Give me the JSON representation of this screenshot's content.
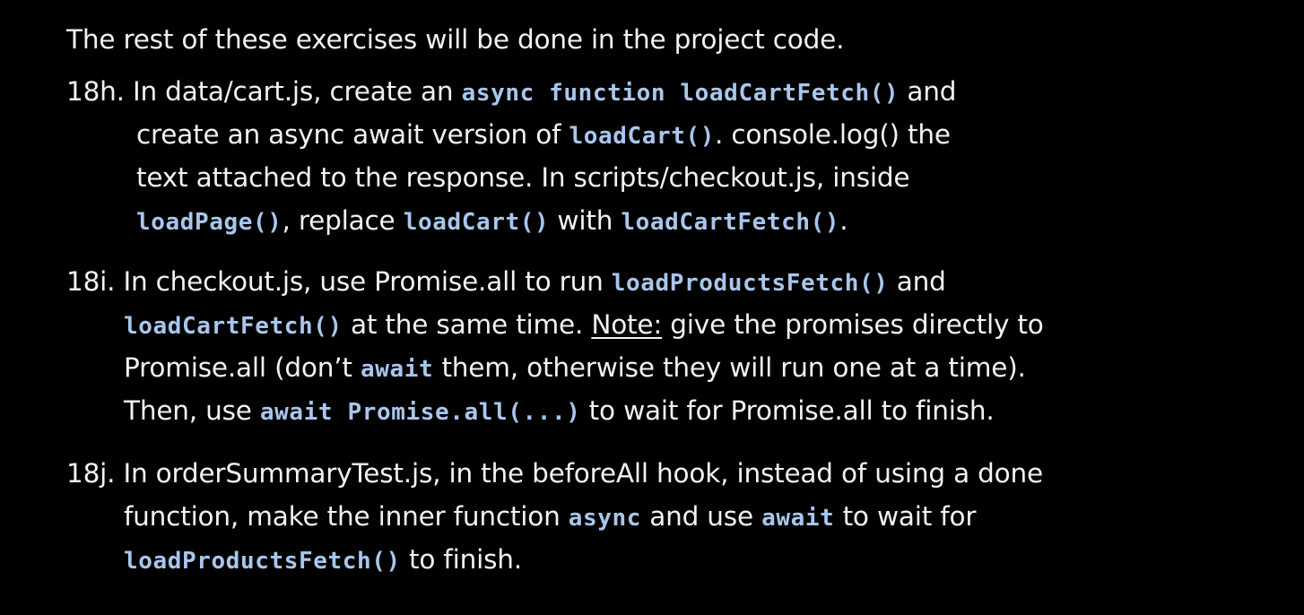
{
  "intro": "The rest of these exercises will be done in the project code.",
  "ex18h": {
    "label": "18h.",
    "l1_a": " In data/cart.js, create an ",
    "l1_code": "async function loadCartFetch()",
    "l1_b": " and",
    "l2_a": "create an async await version of ",
    "l2_code": "loadCart()",
    "l2_b": ". console.log() the",
    "l3": "text attached to the response. In scripts/checkout.js, inside",
    "l4_code1": "loadPage()",
    "l4_a": ", replace ",
    "l4_code2": "loadCart()",
    "l4_b": " with ",
    "l4_code3": "loadCartFetch()",
    "l4_c": "."
  },
  "ex18i": {
    "label": "18i.",
    "l1_a": " In checkout.js, use Promise.all to run ",
    "l1_code": "loadProductsFetch()",
    "l1_b": " and",
    "l2_code": "loadCartFetch()",
    "l2_a": " at the same time. ",
    "l2_note": "Note:",
    "l2_b": " give the promises directly to",
    "l3_a": "Promise.all (don’t ",
    "l3_code": "await",
    "l3_b": " them, otherwise they will run one at a time).",
    "l4_a": "Then, use ",
    "l4_code": "await Promise.all(...)",
    "l4_b": "  to wait for Promise.all to finish."
  },
  "ex18j": {
    "label": "18j.",
    "l1": " In orderSummaryTest.js, in the beforeAll hook, instead of using a done",
    "l2_a": "function, make the inner function ",
    "l2_code1": "async",
    "l2_b": " and use ",
    "l2_code2": "await",
    "l2_c": " to wait for",
    "l3_code": "loadProductsFetch()",
    "l3_a": " to finish."
  }
}
